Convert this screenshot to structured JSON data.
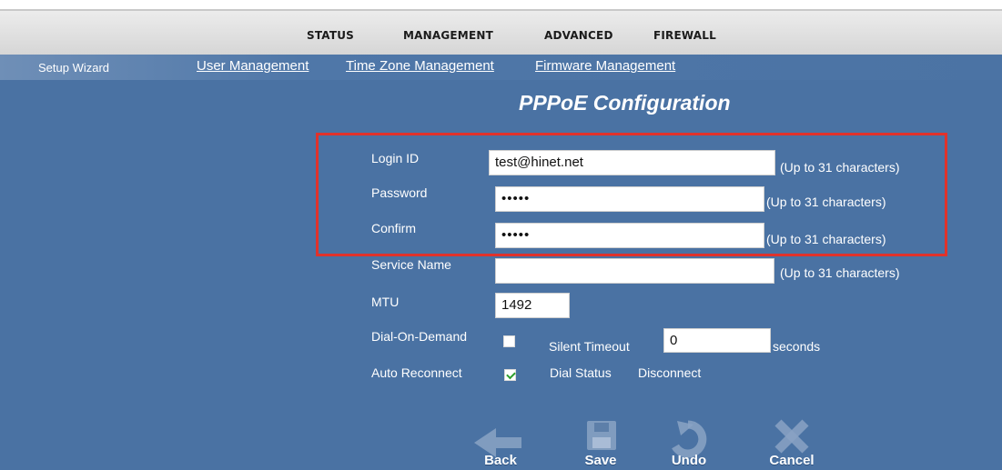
{
  "topnav": {
    "items": [
      "STATUS",
      "MANAGEMENT",
      "ADVANCED",
      "FIREWALL"
    ]
  },
  "subnav": {
    "wizard": "Setup Wizard",
    "links": [
      "User Management",
      "Time Zone Management",
      "Firmware Management"
    ]
  },
  "page": {
    "title": "PPPoE Configuration"
  },
  "form": {
    "login_id_label": "Login ID",
    "login_id_value": "test@hinet.net",
    "password_label": "Password",
    "password_value": "•••••",
    "confirm_label": "Confirm",
    "confirm_value": "•••••",
    "service_name_label": "Service Name",
    "service_name_value": "",
    "mtu_label": "MTU",
    "mtu_value": "1492",
    "dial_on_demand_label": "Dial-On-Demand",
    "dial_on_demand_checked": false,
    "silent_timeout_label": "Silent Timeout",
    "silent_timeout_value": "0",
    "silent_timeout_unit": "seconds",
    "auto_reconnect_label": "Auto Reconnect",
    "auto_reconnect_checked": true,
    "dial_status_label": "Dial Status",
    "dial_status_value": "Disconnect",
    "hint": "(Up to 31 characters)"
  },
  "buttons": {
    "back": "Back",
    "save": "Save",
    "undo": "Undo",
    "cancel": "Cancel"
  },
  "colors": {
    "main_bg": "#4a72a3",
    "highlight_border": "#e0322b"
  }
}
